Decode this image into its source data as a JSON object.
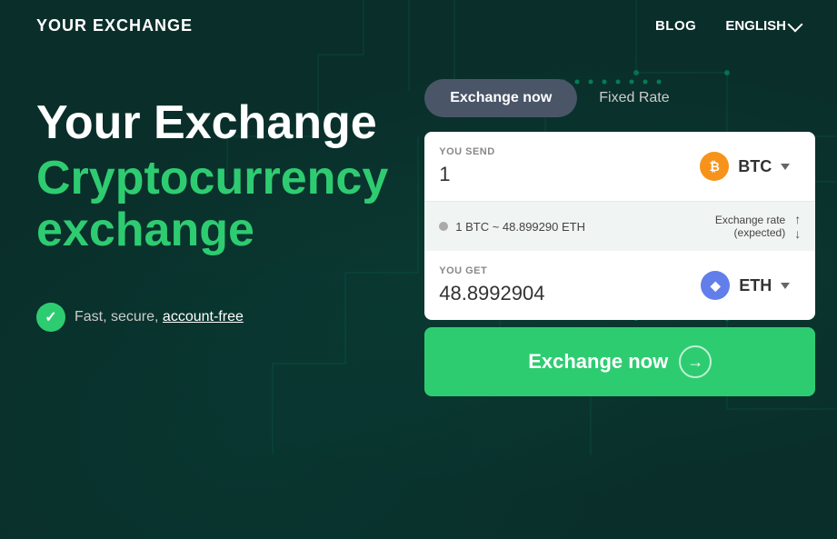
{
  "header": {
    "logo": "YOUR EXCHANGE",
    "nav": {
      "blog": "BLOG",
      "language": "ENGLISH"
    }
  },
  "hero": {
    "title_line1": "Your Exchange",
    "title_line2": "Cryptocurrency",
    "title_line3": "exchange",
    "tagline": "Fast, secure, account-free"
  },
  "widget": {
    "tab_exchange_now": "Exchange now",
    "tab_fixed_rate": "Fixed Rate",
    "you_send_label": "YOU SEND",
    "you_send_value": "1",
    "you_send_currency": "BTC",
    "rate_info": "1 BTC ~ 48.899290 ETH",
    "rate_label": "Exchange rate\n(expected)",
    "you_get_label": "YOU GET",
    "you_get_value": "48.8992904",
    "you_get_currency": "ETH",
    "exchange_button": "Exchange now"
  },
  "icons": {
    "btc": "₿",
    "eth": "♦",
    "check": "✓",
    "arrow_right": "→"
  }
}
